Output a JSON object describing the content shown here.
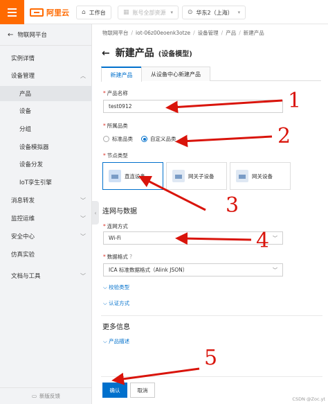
{
  "topbar": {
    "logo_text": "阿里云",
    "workbench": "工作台",
    "account_resources": "账号全部资源",
    "region": "华东2（上海）"
  },
  "sidebar": {
    "title": "物联网平台",
    "items": [
      {
        "label": "实例详情"
      },
      {
        "label": "设备管理"
      },
      {
        "label": "产品"
      },
      {
        "label": "设备"
      },
      {
        "label": "分组"
      },
      {
        "label": "设备模拟器"
      },
      {
        "label": "设备分发"
      },
      {
        "label": "IoT孪生引擎"
      },
      {
        "label": "消息转发"
      },
      {
        "label": "监控运维"
      },
      {
        "label": "安全中心"
      },
      {
        "label": "仿真实验"
      },
      {
        "label": "文档与工具"
      }
    ],
    "footer": "新版反馈"
  },
  "breadcrumb": [
    "物联网平台",
    "iot-06z00eoenk3otze",
    "设备管理",
    "产品",
    "新建产品"
  ],
  "page": {
    "title": "新建产品",
    "subtitle": "(设备模型)"
  },
  "tabs": [
    "新建产品",
    "从设备中心新建产品"
  ],
  "form": {
    "product_name_label": "产品名称",
    "product_name_value": "test0912",
    "category_label": "所属品类",
    "category_options": [
      "标准品类",
      "自定义品类"
    ],
    "category_selected": "自定义品类",
    "node_type_label": "节点类型",
    "node_types": [
      "直连设备",
      "网关子设备",
      "网关设备"
    ],
    "node_type_selected": "直连设备",
    "network_section": "连网与数据",
    "network_method_label": "连网方式",
    "network_method_value": "Wi-Fi",
    "data_format_label": "数据格式",
    "data_format_value": "ICA 标准数据格式（Alink JSON）",
    "verify_type_link": "校验类型",
    "auth_method_link": "认证方式",
    "more_info_section": "更多信息",
    "product_desc_link": "产品描述"
  },
  "buttons": {
    "confirm": "确认",
    "cancel": "取消"
  },
  "annotations": [
    "1",
    "2",
    "3",
    "4",
    "5"
  ],
  "watermark": "CSDN @Zoc.yt",
  "colors": {
    "brand": "#ff6a00",
    "primary": "#0070cc",
    "annotation": "#d9140b"
  }
}
